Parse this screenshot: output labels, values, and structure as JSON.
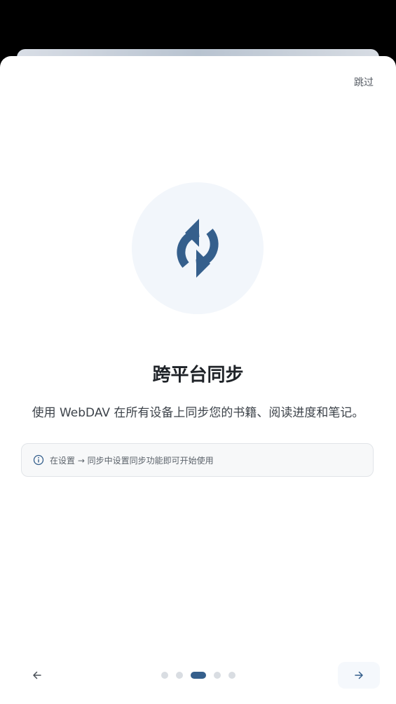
{
  "onboarding": {
    "skip_label": "跳过",
    "hero_icon": "sync-icon",
    "title": "跨平台同步",
    "description": "使用 WebDAV 在所有设备上同步您的书籍、阅读进度和笔记。",
    "tip": {
      "icon": "info-icon",
      "text": "在设置 → 同步中设置同步功能即可开始使用"
    },
    "pagination": {
      "total_pages": 5,
      "current_page": 3
    },
    "back_icon": "arrow-left-icon",
    "next_icon": "arrow-right-icon"
  },
  "colors": {
    "accent": "#355f8c",
    "hero_background": "#f2f6fb",
    "dot_inactive": "#d9dde2"
  }
}
